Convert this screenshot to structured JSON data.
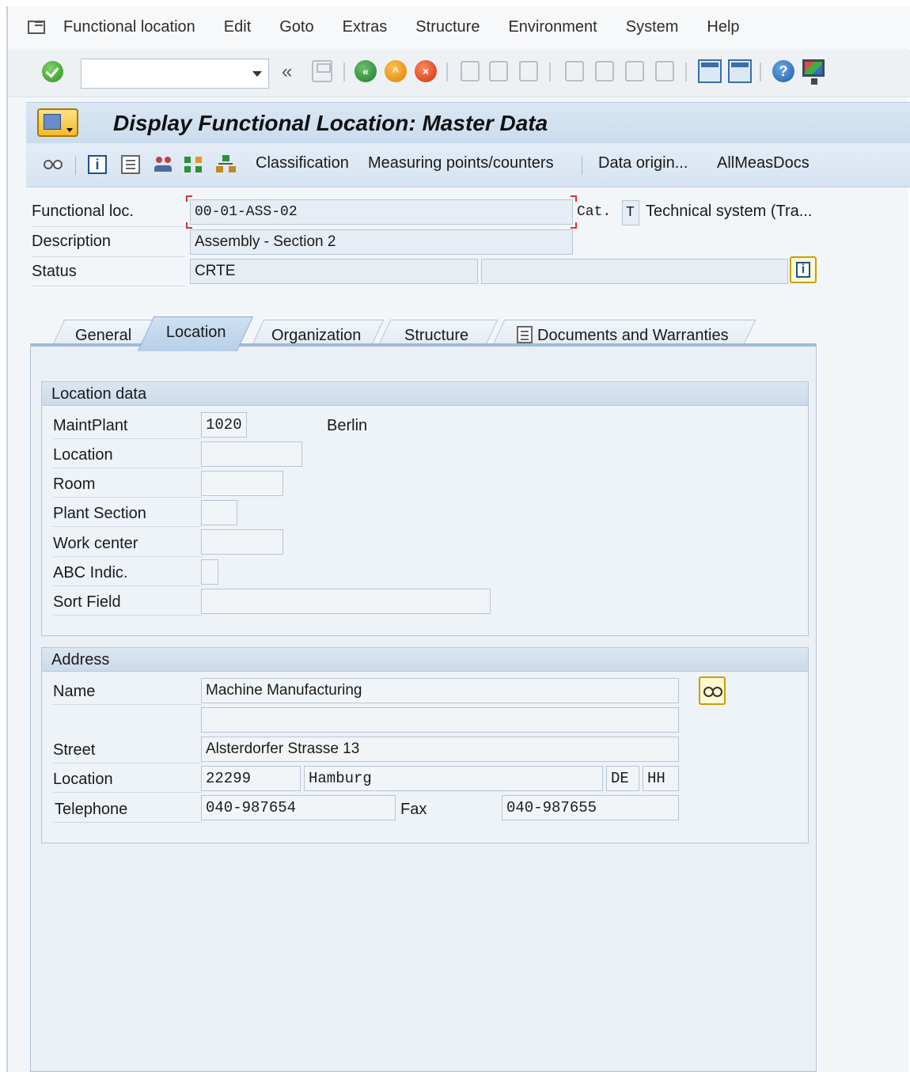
{
  "menu": [
    "Functional location",
    "Edit",
    "Goto",
    "Extras",
    "Structure",
    "Environment",
    "System",
    "Help"
  ],
  "toolbar": {
    "command_value": "",
    "history_glyph": "«"
  },
  "title": "Display Functional Location: Master Data",
  "app_toolbar": {
    "classification": "Classification",
    "measuring": "Measuring points/counters",
    "data_origin": "Data origin...",
    "allmeas": "AllMeasDocs"
  },
  "header": {
    "functional_loc_label": "Functional loc.",
    "functional_loc_value": "00-01-ASS-02",
    "cat_label": "Cat.",
    "cat_value": "T",
    "cat_text": "Technical system (Tra...",
    "description_label": "Description",
    "description_value": "Assembly - Section 2",
    "status_label": "Status",
    "status_value": "CRTE",
    "status_value2": ""
  },
  "tabs": [
    {
      "label": "General"
    },
    {
      "label": "Location",
      "active": true
    },
    {
      "label": "Organization"
    },
    {
      "label": "Structure"
    },
    {
      "label": "Documents and Warranties"
    }
  ],
  "location_data": {
    "title": "Location data",
    "maintplant_label": "MaintPlant",
    "maintplant_value": "1020",
    "maintplant_text": "Berlin",
    "location_label": "Location",
    "location_value": "",
    "room_label": "Room",
    "room_value": "",
    "plant_section_label": "Plant Section",
    "plant_section_value": "",
    "work_center_label": "Work center",
    "work_center_value": "",
    "abc_label": "ABC Indic.",
    "abc_value": "",
    "sort_label": "Sort Field",
    "sort_value": ""
  },
  "address": {
    "title": "Address",
    "name_label": "Name",
    "name_value": "Machine Manufacturing",
    "name2_value": "",
    "street_label": "Street",
    "street_value": "Alsterdorfer Strasse 13",
    "location_label": "Location",
    "postal_code": "22299",
    "city": "Hamburg",
    "country": "DE",
    "region": "HH",
    "telephone_label": "Telephone",
    "telephone_value": "040-987654",
    "fax_label": "Fax",
    "fax_value": "040-987655"
  },
  "colors": {
    "title_bar": "#c9dcee",
    "active_tab": "#b7cfe8",
    "enter": "#2e8f22",
    "required": "#dd3333"
  }
}
